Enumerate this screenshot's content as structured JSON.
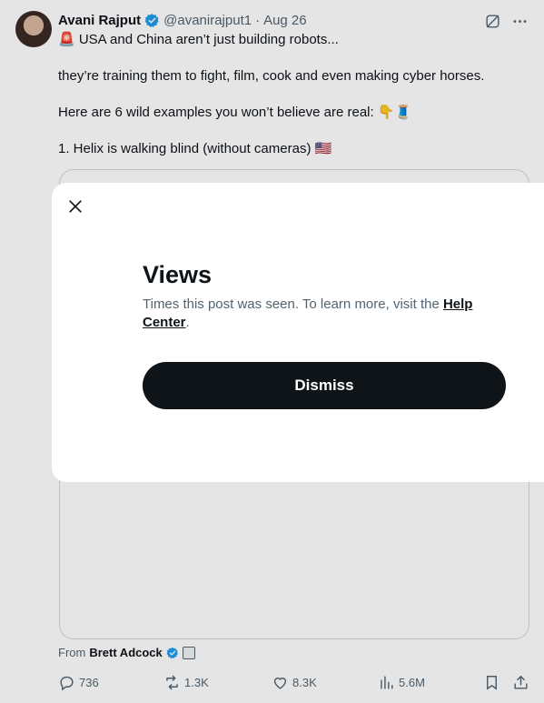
{
  "tweet": {
    "author": {
      "display_name": "Avani Rajput",
      "handle": "@avanirajput1",
      "separator": "·",
      "date": "Aug 26"
    },
    "lines": [
      "🚨 USA and China aren’t just building robots...",
      "they’re training them to fight, film, cook and even making cyber horses.",
      "Here are 6 wild examples you won’t believe are real: 👇🧵",
      "1. Helix is walking blind (without cameras) 🇺🇸"
    ],
    "from": {
      "prefix": "From",
      "name": "Brett Adcock"
    },
    "actions": {
      "replies": "736",
      "reposts": "1.3K",
      "likes": "8.3K",
      "views": "5.6M"
    },
    "icons": [
      "grok-icon",
      "more-icon",
      "reply-icon",
      "repost-icon",
      "like-icon",
      "views-icon",
      "bookmark-icon",
      "share-icon",
      "verified-badge-icon",
      "close-icon"
    ]
  },
  "modal": {
    "title": "Views",
    "description": "Times this post was seen. To learn more, visit the ",
    "link": "Help Center",
    "period": ".",
    "dismiss_label": "Dismiss"
  },
  "colors": {
    "text_primary": "#0f1419",
    "text_secondary": "#536471",
    "verified_blue": "#1d9bf0",
    "border": "#cfd9de",
    "button_bg": "#0f1419",
    "overlay": "rgba(0,0,0,0.10)"
  }
}
